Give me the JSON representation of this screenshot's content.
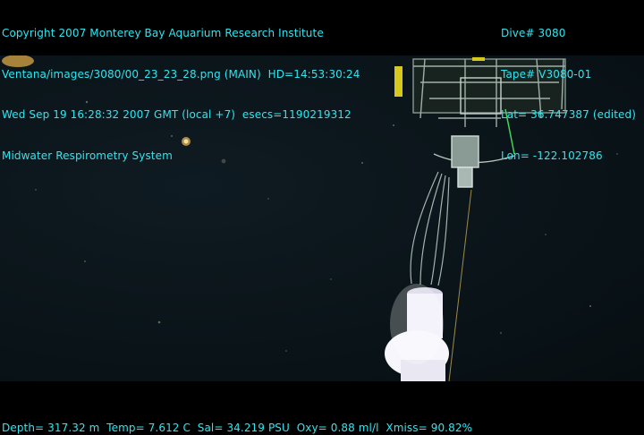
{
  "header_left": {
    "line1": "Copyright 2007 Monterey Bay Aquarium Research Institute",
    "line2": "Ventana/images/3080/00_23_23_28.png (MAIN)  HD=14:53:30:24",
    "line3": "Wed Sep 19 16:28:32 2007 GMT (local +7)  esecs=1190219312",
    "line4": "Midwater Respirometry System"
  },
  "header_right": {
    "line1": "Dive# 3080",
    "line2": "Tape# V3080-01",
    "line3": "Lat= 36.747387 (edited)",
    "line4": "Lon= -122.102786"
  },
  "footer": {
    "telemetry": "Depth= 317.32 m  Temp= 7.612 C  Sal= 34.219 PSU  Oxy= 0.88 ml/l  Xmiss= 90.82%"
  },
  "colors": {
    "overlay_text": "#2de6f0",
    "water": "#0a1419"
  }
}
